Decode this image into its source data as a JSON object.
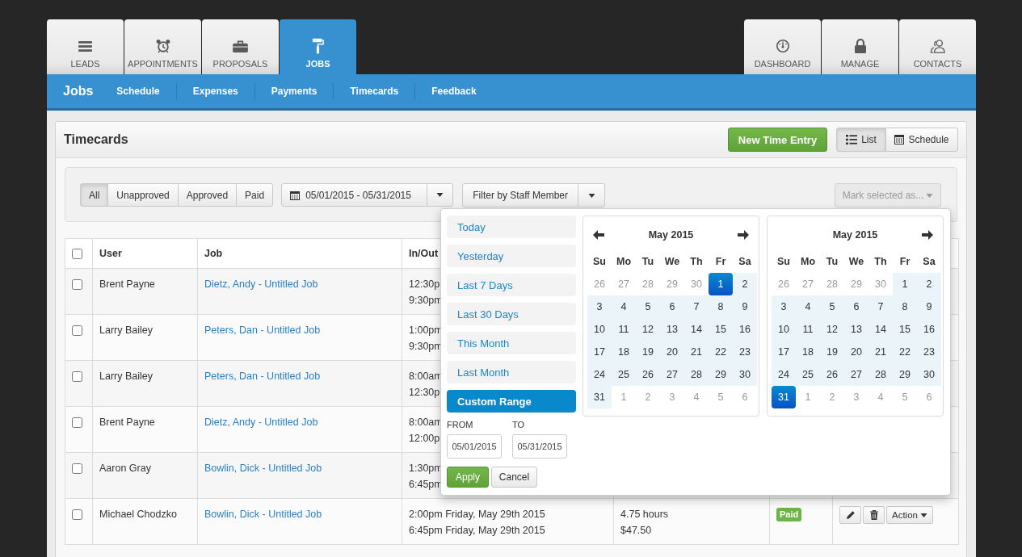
{
  "top_tabs": [
    {
      "label": "LEADS",
      "selected": false
    },
    {
      "label": "APPOINTMENTS",
      "selected": false
    },
    {
      "label": "PROPOSALS",
      "selected": false
    },
    {
      "label": "JOBS",
      "selected": true
    }
  ],
  "right_tabs": [
    {
      "label": "DASHBOARD",
      "selected": false
    },
    {
      "label": "MANAGE",
      "selected": false
    },
    {
      "label": "CONTACTS",
      "selected": false
    }
  ],
  "sub_nav": {
    "title": "Jobs",
    "items": [
      "Schedule",
      "Expenses",
      "Payments",
      "Timecards",
      "Feedback"
    ]
  },
  "panel": {
    "title": "Timecards",
    "new_button": "New Time Entry",
    "views": [
      {
        "label": "List",
        "selected": true
      },
      {
        "label": "Schedule",
        "selected": false
      }
    ]
  },
  "filters": {
    "statuses": [
      {
        "label": "All",
        "selected": true
      },
      {
        "label": "Unapproved",
        "selected": false
      },
      {
        "label": "Approved",
        "selected": false
      },
      {
        "label": "Paid",
        "selected": false
      }
    ],
    "date_range": "05/01/2015 - 05/31/2015",
    "staff_filter": "Filter by Staff Member",
    "mark_selected": {
      "label": "Mark selected as...",
      "disabled": true
    }
  },
  "table": {
    "all_checked": false,
    "columns": [
      "User",
      "Job",
      "In/Out"
    ],
    "rows": [
      {
        "checked": false,
        "user": "Brent Payne",
        "job": "Dietz, Andy - Untitled Job",
        "in_out": [
          "12:30p",
          "9:30pm"
        ]
      },
      {
        "checked": false,
        "user": "Larry Bailey",
        "job": "Peters, Dan - Untitled Job",
        "in_out": [
          "1:00pm",
          "9:30pm"
        ]
      },
      {
        "checked": false,
        "user": "Larry Bailey",
        "job": "Peters, Dan - Untitled Job",
        "in_out": [
          "8:00am",
          "12:30p"
        ]
      },
      {
        "checked": false,
        "user": "Brent Payne",
        "job": "Dietz, Andy - Untitled Job",
        "in_out": [
          "8:00am",
          "12:00p"
        ]
      },
      {
        "checked": false,
        "user": "Aaron Gray",
        "job": "Bowlin, Dick - Untitled Job",
        "in_out": [
          "1:30pm",
          "6:45pm"
        ]
      },
      {
        "checked": false,
        "user": "Michael Chodzko",
        "job": "Bowlin, Dick - Untitled Job",
        "in_out": [
          "2:00pm Friday, May 29th 2015",
          "6:45pm Friday, May 29th 2015"
        ],
        "column_4": [
          "4.75 hours",
          "$47.50"
        ],
        "status": "Paid",
        "action": "Action"
      }
    ]
  },
  "date_picker": {
    "ranges": [
      {
        "label": "Today",
        "selected": false
      },
      {
        "label": "Yesterday",
        "selected": false
      },
      {
        "label": "Last 7 Days",
        "selected": false
      },
      {
        "label": "Last 30 Days",
        "selected": false
      },
      {
        "label": "This Month",
        "selected": false
      },
      {
        "label": "Last Month",
        "selected": false
      },
      {
        "label": "Custom Range",
        "selected": true
      }
    ],
    "from_label": "FROM",
    "from": "05/01/2015",
    "to_label": "TO",
    "to": "05/31/2015",
    "apply": "Apply",
    "cancel": "Cancel",
    "calendars": [
      {
        "title": "May 2015",
        "prev_arrow": true,
        "next_arrow": true,
        "weekdays": [
          "Su",
          "Mo",
          "Tu",
          "We",
          "Th",
          "Fr",
          "Sa"
        ],
        "weeks": [
          [
            {
              "day": "26",
              "muted": true,
              "in_range": false,
              "selected": false
            },
            {
              "day": "27",
              "muted": true,
              "in_range": false,
              "selected": false
            },
            {
              "day": "28",
              "muted": true,
              "in_range": false,
              "selected": false
            },
            {
              "day": "29",
              "muted": true,
              "in_range": false,
              "selected": false
            },
            {
              "day": "30",
              "muted": true,
              "in_range": false,
              "selected": false
            },
            {
              "day": "1",
              "muted": false,
              "in_range": true,
              "selected": true
            },
            {
              "day": "2",
              "muted": false,
              "in_range": true,
              "selected": false
            }
          ],
          [
            {
              "day": "3",
              "muted": false,
              "in_range": true,
              "selected": false
            },
            {
              "day": "4",
              "muted": false,
              "in_range": true,
              "selected": false
            },
            {
              "day": "5",
              "muted": false,
              "in_range": true,
              "selected": false
            },
            {
              "day": "6",
              "muted": false,
              "in_range": true,
              "selected": false
            },
            {
              "day": "7",
              "muted": false,
              "in_range": true,
              "selected": false
            },
            {
              "day": "8",
              "muted": false,
              "in_range": true,
              "selected": false
            },
            {
              "day": "9",
              "muted": false,
              "in_range": true,
              "selected": false
            }
          ],
          [
            {
              "day": "10",
              "muted": false,
              "in_range": true,
              "selected": false
            },
            {
              "day": "11",
              "muted": false,
              "in_range": true,
              "selected": false
            },
            {
              "day": "12",
              "muted": false,
              "in_range": true,
              "selected": false
            },
            {
              "day": "13",
              "muted": false,
              "in_range": true,
              "selected": false
            },
            {
              "day": "14",
              "muted": false,
              "in_range": true,
              "selected": false
            },
            {
              "day": "15",
              "muted": false,
              "in_range": true,
              "selected": false
            },
            {
              "day": "16",
              "muted": false,
              "in_range": true,
              "selected": false
            }
          ],
          [
            {
              "day": "17",
              "muted": false,
              "in_range": true,
              "selected": false
            },
            {
              "day": "18",
              "muted": false,
              "in_range": true,
              "selected": false
            },
            {
              "day": "19",
              "muted": false,
              "in_range": true,
              "selected": false
            },
            {
              "day": "20",
              "muted": false,
              "in_range": true,
              "selected": false
            },
            {
              "day": "21",
              "muted": false,
              "in_range": true,
              "selected": false
            },
            {
              "day": "22",
              "muted": false,
              "in_range": true,
              "selected": false
            },
            {
              "day": "23",
              "muted": false,
              "in_range": true,
              "selected": false
            }
          ],
          [
            {
              "day": "24",
              "muted": false,
              "in_range": true,
              "selected": false
            },
            {
              "day": "25",
              "muted": false,
              "in_range": true,
              "selected": false
            },
            {
              "day": "26",
              "muted": false,
              "in_range": true,
              "selected": false
            },
            {
              "day": "27",
              "muted": false,
              "in_range": true,
              "selected": false
            },
            {
              "day": "28",
              "muted": false,
              "in_range": true,
              "selected": false
            },
            {
              "day": "29",
              "muted": false,
              "in_range": true,
              "selected": false
            },
            {
              "day": "30",
              "muted": false,
              "in_range": true,
              "selected": false
            }
          ],
          [
            {
              "day": "31",
              "muted": false,
              "in_range": true,
              "selected": false
            },
            {
              "day": "1",
              "muted": true,
              "in_range": false,
              "selected": false
            },
            {
              "day": "2",
              "muted": true,
              "in_range": false,
              "selected": false
            },
            {
              "day": "3",
              "muted": true,
              "in_range": false,
              "selected": false
            },
            {
              "day": "4",
              "muted": true,
              "in_range": false,
              "selected": false
            },
            {
              "day": "5",
              "muted": true,
              "in_range": false,
              "selected": false
            },
            {
              "day": "6",
              "muted": true,
              "in_range": false,
              "selected": false
            }
          ]
        ]
      },
      {
        "title": "May 2015",
        "prev_arrow": false,
        "next_arrow": true,
        "weekdays": [
          "Su",
          "Mo",
          "Tu",
          "We",
          "Th",
          "Fr",
          "Sa"
        ],
        "weeks": [
          [
            {
              "day": "26",
              "muted": true,
              "in_range": false,
              "selected": false
            },
            {
              "day": "27",
              "muted": true,
              "in_range": false,
              "selected": false
            },
            {
              "day": "28",
              "muted": true,
              "in_range": false,
              "selected": false
            },
            {
              "day": "29",
              "muted": true,
              "in_range": false,
              "selected": false
            },
            {
              "day": "30",
              "muted": true,
              "in_range": false,
              "selected": false
            },
            {
              "day": "1",
              "muted": false,
              "in_range": true,
              "selected": false
            },
            {
              "day": "2",
              "muted": false,
              "in_range": true,
              "selected": false
            }
          ],
          [
            {
              "day": "3",
              "muted": false,
              "in_range": true,
              "selected": false
            },
            {
              "day": "4",
              "muted": false,
              "in_range": true,
              "selected": false
            },
            {
              "day": "5",
              "muted": false,
              "in_range": true,
              "selected": false
            },
            {
              "day": "6",
              "muted": false,
              "in_range": true,
              "selected": false
            },
            {
              "day": "7",
              "muted": false,
              "in_range": true,
              "selected": false
            },
            {
              "day": "8",
              "muted": false,
              "in_range": true,
              "selected": false
            },
            {
              "day": "9",
              "muted": false,
              "in_range": true,
              "selected": false
            }
          ],
          [
            {
              "day": "10",
              "muted": false,
              "in_range": true,
              "selected": false
            },
            {
              "day": "11",
              "muted": false,
              "in_range": true,
              "selected": false
            },
            {
              "day": "12",
              "muted": false,
              "in_range": true,
              "selected": false
            },
            {
              "day": "13",
              "muted": false,
              "in_range": true,
              "selected": false
            },
            {
              "day": "14",
              "muted": false,
              "in_range": true,
              "selected": false
            },
            {
              "day": "15",
              "muted": false,
              "in_range": true,
              "selected": false
            },
            {
              "day": "16",
              "muted": false,
              "in_range": true,
              "selected": false
            }
          ],
          [
            {
              "day": "17",
              "muted": false,
              "in_range": true,
              "selected": false
            },
            {
              "day": "18",
              "muted": false,
              "in_range": true,
              "selected": false
            },
            {
              "day": "19",
              "muted": false,
              "in_range": true,
              "selected": false
            },
            {
              "day": "20",
              "muted": false,
              "in_range": true,
              "selected": false
            },
            {
              "day": "21",
              "muted": false,
              "in_range": true,
              "selected": false
            },
            {
              "day": "22",
              "muted": false,
              "in_range": true,
              "selected": false
            },
            {
              "day": "23",
              "muted": false,
              "in_range": true,
              "selected": false
            }
          ],
          [
            {
              "day": "24",
              "muted": false,
              "in_range": true,
              "selected": false
            },
            {
              "day": "25",
              "muted": false,
              "in_range": true,
              "selected": false
            },
            {
              "day": "26",
              "muted": false,
              "in_range": true,
              "selected": false
            },
            {
              "day": "27",
              "muted": false,
              "in_range": true,
              "selected": false
            },
            {
              "day": "28",
              "muted": false,
              "in_range": true,
              "selected": false
            },
            {
              "day": "29",
              "muted": false,
              "in_range": true,
              "selected": false
            },
            {
              "day": "30",
              "muted": false,
              "in_range": true,
              "selected": false
            }
          ],
          [
            {
              "day": "31",
              "muted": false,
              "in_range": true,
              "selected": true
            },
            {
              "day": "1",
              "muted": true,
              "in_range": false,
              "selected": false
            },
            {
              "day": "2",
              "muted": true,
              "in_range": false,
              "selected": false
            },
            {
              "day": "3",
              "muted": true,
              "in_range": false,
              "selected": false
            },
            {
              "day": "4",
              "muted": true,
              "in_range": false,
              "selected": false
            },
            {
              "day": "5",
              "muted": true,
              "in_range": false,
              "selected": false
            },
            {
              "day": "6",
              "muted": true,
              "in_range": false,
              "selected": false
            }
          ]
        ]
      }
    ]
  }
}
